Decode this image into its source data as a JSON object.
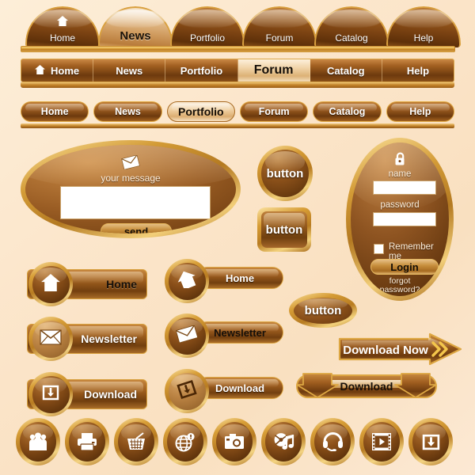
{
  "palette": {
    "background": "#fce8cd",
    "gold": "#d9a03f",
    "brown_dark": "#5e3009",
    "brown_mid": "#8c4a18",
    "text_light": "#ffffff",
    "text_dark": "#16100a"
  },
  "dome_nav": {
    "items": [
      {
        "label": "Home",
        "active": false,
        "icon": "home-icon"
      },
      {
        "label": "News",
        "active": true,
        "icon": ""
      },
      {
        "label": "Portfolio",
        "active": false,
        "icon": ""
      },
      {
        "label": "Forum",
        "active": false,
        "icon": ""
      },
      {
        "label": "Catalog",
        "active": false,
        "icon": ""
      },
      {
        "label": "Help",
        "active": false,
        "icon": ""
      }
    ]
  },
  "bar_nav": {
    "items": [
      {
        "label": "Home",
        "active": false,
        "icon": "home-icon"
      },
      {
        "label": "News",
        "active": false,
        "icon": ""
      },
      {
        "label": "Portfolio",
        "active": false,
        "icon": ""
      },
      {
        "label": "Forum",
        "active": true,
        "icon": ""
      },
      {
        "label": "Catalog",
        "active": false,
        "icon": ""
      },
      {
        "label": "Help",
        "active": false,
        "icon": ""
      }
    ]
  },
  "pill_nav": {
    "items": [
      {
        "label": "Home",
        "active": false
      },
      {
        "label": "News",
        "active": false
      },
      {
        "label": "Portfolio",
        "active": true
      },
      {
        "label": "Forum",
        "active": false
      },
      {
        "label": "Catalog",
        "active": false
      },
      {
        "label": "Help",
        "active": false
      }
    ]
  },
  "message_panel": {
    "icon": "envelope-icon",
    "label": "your message",
    "textarea_value": "",
    "textarea_placeholder": "",
    "send_label": "send"
  },
  "login_panel": {
    "icon": "lock-icon",
    "name_label": "name",
    "name_value": "",
    "password_label": "password",
    "password_value": "",
    "remember_label": "Remember me",
    "remember_checked": false,
    "login_label": "Login",
    "forgot_line1": "forgot",
    "forgot_line2": "password?"
  },
  "plain_buttons": {
    "circle_label": "button",
    "square_label": "button",
    "oval_label": "button"
  },
  "left_buttons": [
    {
      "label": "Home",
      "icon": "home-icon",
      "label_color": "#16100a",
      "badge_style": "dark"
    },
    {
      "label": "Newsletter",
      "icon": "envelope-icon",
      "label_color": "#ffffff",
      "badge_style": "light"
    },
    {
      "label": "Download",
      "icon": "download-tray-icon",
      "label_color": "#ffffff",
      "badge_style": "dark"
    }
  ],
  "mid_buttons": [
    {
      "label": "Home",
      "icon": "home-flip-icon",
      "badge_style": "dark"
    },
    {
      "label": "Newsletter",
      "icon": "envelope-open-icon",
      "badge_style": "dark",
      "label_color": "#16100a"
    },
    {
      "label": "Download",
      "icon": "download-arrow-icon",
      "badge_style": "light"
    }
  ],
  "arrow_buttons": {
    "download_now_label": "Download Now",
    "download_now_icon": "double-chevron-right-icon",
    "download_label": "Download"
  },
  "icon_row": [
    {
      "name": "users-icon"
    },
    {
      "name": "printer-icon"
    },
    {
      "name": "shopping-basket-icon"
    },
    {
      "name": "globe-pin-icon"
    },
    {
      "name": "camera-icon"
    },
    {
      "name": "music-cd-icon"
    },
    {
      "name": "headset-icon"
    },
    {
      "name": "film-play-icon"
    },
    {
      "name": "download-tray-icon"
    }
  ]
}
